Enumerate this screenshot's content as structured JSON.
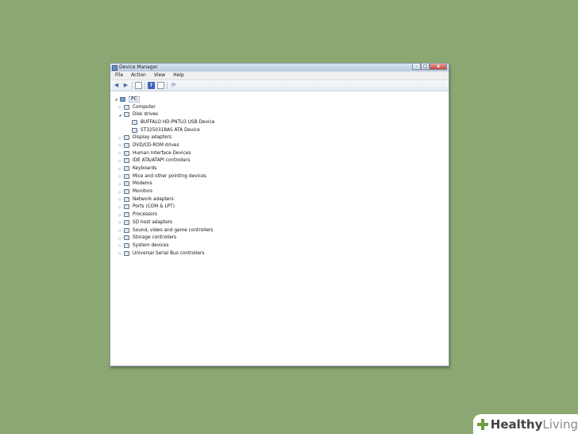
{
  "window": {
    "title": "Device Manager",
    "close_glyph": "x",
    "min_glyph": "-",
    "max_glyph": "□"
  },
  "menu": [
    "File",
    "Action",
    "View",
    "Help"
  ],
  "toolbar": {
    "help_glyph": "?"
  },
  "tree": {
    "root": "PC",
    "items": [
      {
        "label": "Computer",
        "expander": "▷",
        "level": 1,
        "icon": "computer-icon"
      },
      {
        "label": "Disk drives",
        "expander": "◢",
        "level": 1,
        "icon": "disk-drive-icon"
      },
      {
        "label": "BUFFALO HD-PNTU3 USB Device",
        "expander": "",
        "level": 2,
        "icon": "disk-icon"
      },
      {
        "label": "ST3250318AS ATA Device",
        "expander": "",
        "level": 2,
        "icon": "disk-icon"
      },
      {
        "label": "Display adapters",
        "expander": "▷",
        "level": 1,
        "icon": "display-adapter-icon"
      },
      {
        "label": "DVD/CD-ROM drives",
        "expander": "▷",
        "level": 1,
        "icon": "dvd-drive-icon"
      },
      {
        "label": "Human Interface Devices",
        "expander": "▷",
        "level": 1,
        "icon": "hid-icon"
      },
      {
        "label": "IDE ATA/ATAPI controllers",
        "expander": "▷",
        "level": 1,
        "icon": "ide-controller-icon"
      },
      {
        "label": "Keyboards",
        "expander": "▷",
        "level": 1,
        "icon": "keyboard-icon"
      },
      {
        "label": "Mice and other pointing devices",
        "expander": "▷",
        "level": 1,
        "icon": "mouse-icon"
      },
      {
        "label": "Modems",
        "expander": "▷",
        "level": 1,
        "icon": "modem-icon"
      },
      {
        "label": "Monitors",
        "expander": "▷",
        "level": 1,
        "icon": "monitor-icon"
      },
      {
        "label": "Network adapters",
        "expander": "▷",
        "level": 1,
        "icon": "network-adapter-icon"
      },
      {
        "label": "Ports (COM & LPT)",
        "expander": "▷",
        "level": 1,
        "icon": "port-icon"
      },
      {
        "label": "Processors",
        "expander": "▷",
        "level": 1,
        "icon": "processor-icon"
      },
      {
        "label": "SD host adapters",
        "expander": "▷",
        "level": 1,
        "icon": "sd-adapter-icon"
      },
      {
        "label": "Sound, video and game controllers",
        "expander": "▷",
        "level": 1,
        "icon": "sound-icon"
      },
      {
        "label": "Storage controllers",
        "expander": "▷",
        "level": 1,
        "icon": "storage-controller-icon"
      },
      {
        "label": "System devices",
        "expander": "▷",
        "level": 1,
        "icon": "system-device-icon"
      },
      {
        "label": "Universal Serial Bus controllers",
        "expander": "▷",
        "level": 1,
        "icon": "usb-icon"
      }
    ]
  },
  "watermark": {
    "word1": "Healthy",
    "word2": "Living"
  },
  "colors": {
    "background": "#8ba872",
    "brand_green": "#6f9e3e"
  }
}
